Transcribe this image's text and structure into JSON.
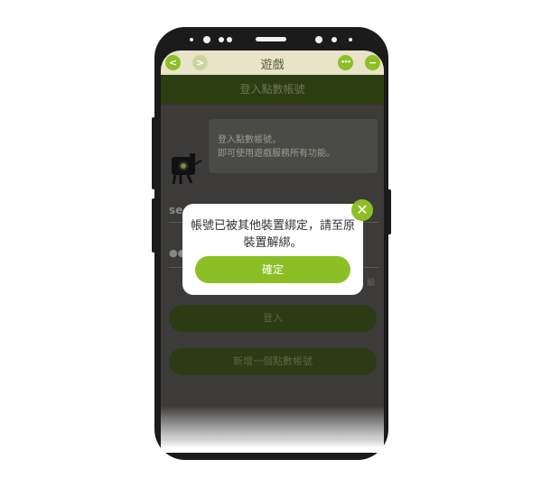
{
  "header": {
    "title": "遊戲",
    "back_glyph": "<",
    "forward_glyph": ">",
    "more_glyph": "•••",
    "minimize_glyph": "−"
  },
  "login_bar": {
    "label": "登入點數帳號"
  },
  "info_bubble": {
    "line1": "登入點數帳號，",
    "line2": "即可使用遊戲服務所有功能。"
  },
  "form": {
    "account_value": "se",
    "password_value": "●●",
    "side_link": "設"
  },
  "buttons": {
    "login": "登入",
    "register": "新增一個點數帳號"
  },
  "dialog": {
    "message_line1": "帳號已被其他裝置綁定，請至原",
    "message_line2": "裝置解綁。",
    "confirm_label": "確定",
    "close_glyph": "✕"
  },
  "colors": {
    "accent": "#8cbf26",
    "topbar": "#e9e3c8",
    "overlay": "#3c3b3a"
  }
}
